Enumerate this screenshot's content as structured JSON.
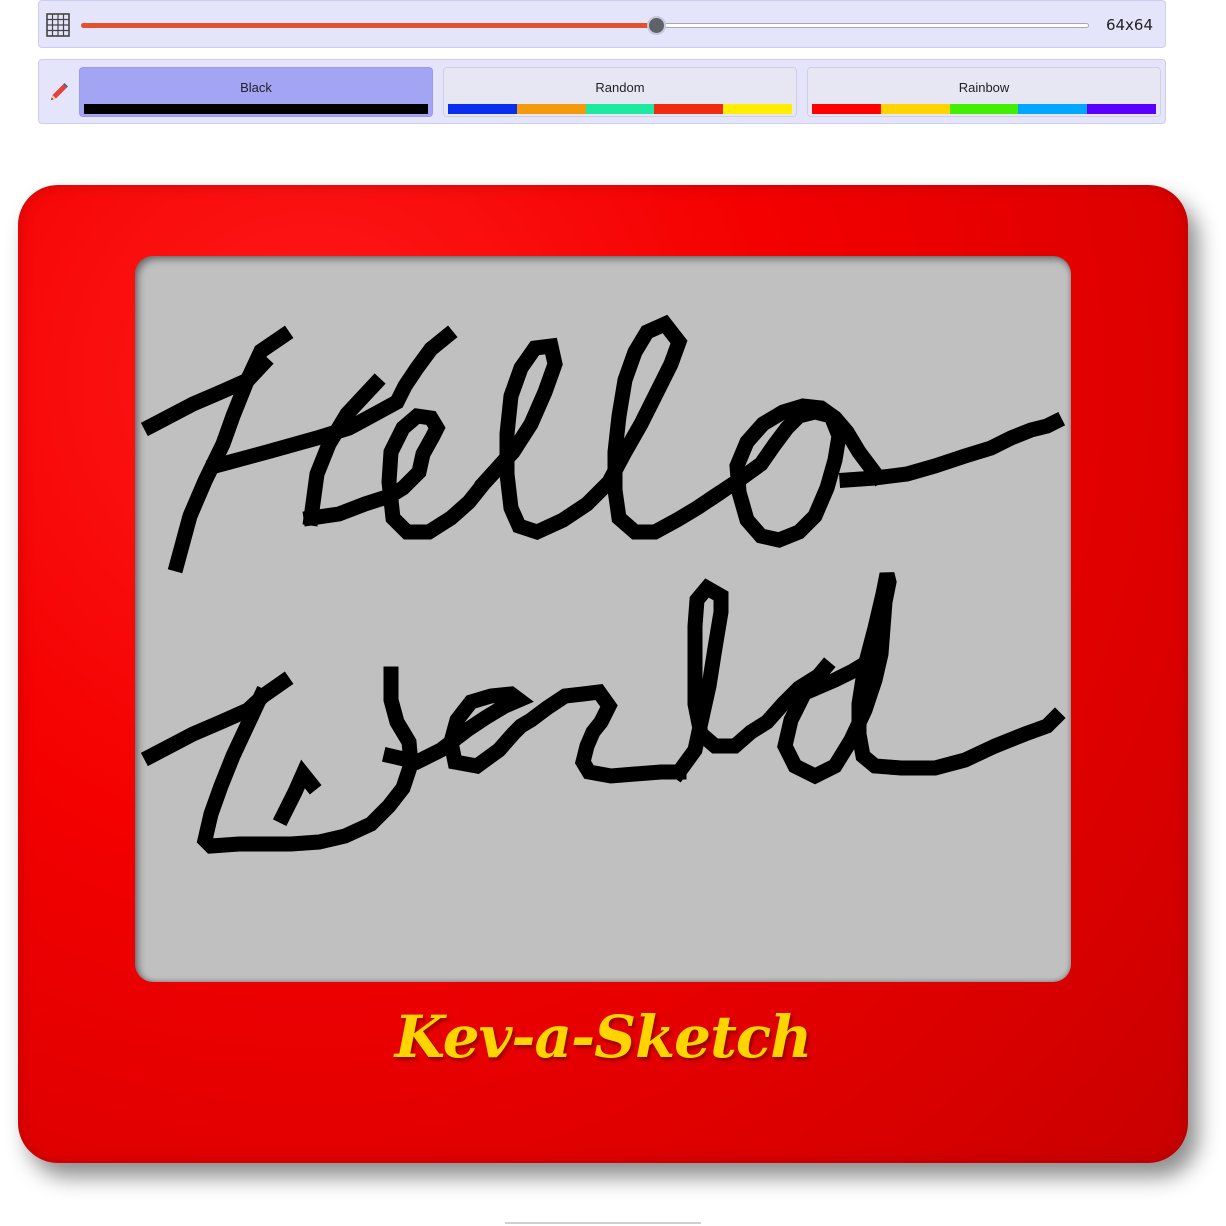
{
  "grid": {
    "size_label": "64x64",
    "slider_fraction": 0.57,
    "icon": "grid-icon",
    "fill_color": "#e2512b"
  },
  "modes": {
    "icon": "pencil-icon",
    "items": [
      {
        "label": "Black",
        "active": true,
        "swatches": [
          "#000000"
        ]
      },
      {
        "label": "Random",
        "active": false,
        "swatches": [
          "#0a2ef0",
          "#f59a0b",
          "#1de9a0",
          "#ef2a10",
          "#ffee00"
        ]
      },
      {
        "label": "Rainbow",
        "active": false,
        "swatches": [
          "#ff0000",
          "#ffd400",
          "#44ee00",
          "#00a6ff",
          "#5a00ff"
        ]
      }
    ]
  },
  "sketch": {
    "brand": "Kev-a-Sketch",
    "frame_color": "#ee0000",
    "screen_color": "#c0c0c0",
    "ink_color": "#000000"
  }
}
